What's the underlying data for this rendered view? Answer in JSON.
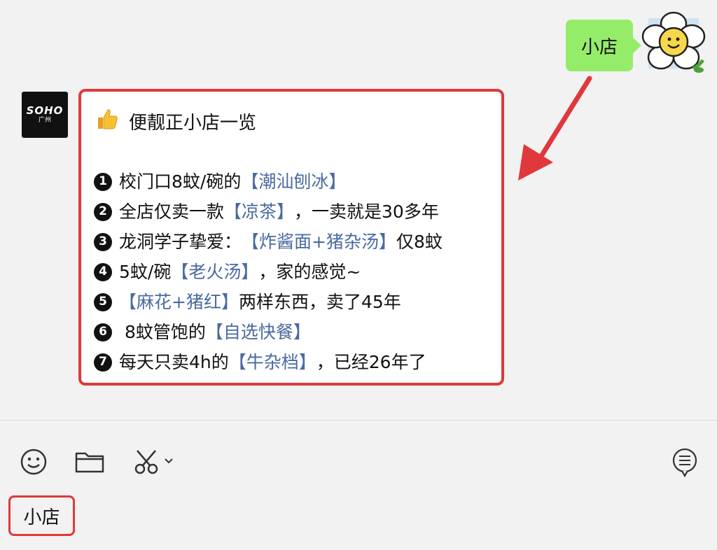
{
  "chat": {
    "outgoing_message": "小店",
    "incoming": {
      "title": "便靓正小店一览",
      "lines": [
        {
          "num": "1",
          "before": "校门口8蚊/碗的",
          "link": "【潮汕刨冰】",
          "after": ""
        },
        {
          "num": "2",
          "before": "全店仅卖一款",
          "link": "【凉茶】",
          "after": "，一卖就是30多年"
        },
        {
          "num": "3",
          "before": "龙洞学子挚爱：",
          "link": "【炸酱面+猪杂汤】",
          "after": "仅8蚊"
        },
        {
          "num": "4",
          "before": "5蚊/碗",
          "link": "【老火汤】",
          "after": "，家的感觉~"
        },
        {
          "num": "5",
          "before": "",
          "link": "【麻花+猪红】",
          "after": "两样东西，卖了45年"
        },
        {
          "num": "6",
          "before": " 8蚊管饱的",
          "link": "【自选快餐】",
          "after": ""
        },
        {
          "num": "7",
          "before": "每天只卖4h的",
          "link": "【牛杂档】",
          "after": "，已经26年了"
        }
      ]
    },
    "sender_avatar": {
      "line1": "SOHO",
      "line2": "广州"
    }
  },
  "input": {
    "text": "小店"
  },
  "icons": {
    "emoji": "emoji-icon",
    "folder": "folder-icon",
    "scissors": "scissors-icon",
    "chat_history": "chat-history-icon"
  },
  "colors": {
    "bubble_green": "#95ec69",
    "highlight_red": "#e0383c",
    "link_blue": "#4a6aa0"
  }
}
